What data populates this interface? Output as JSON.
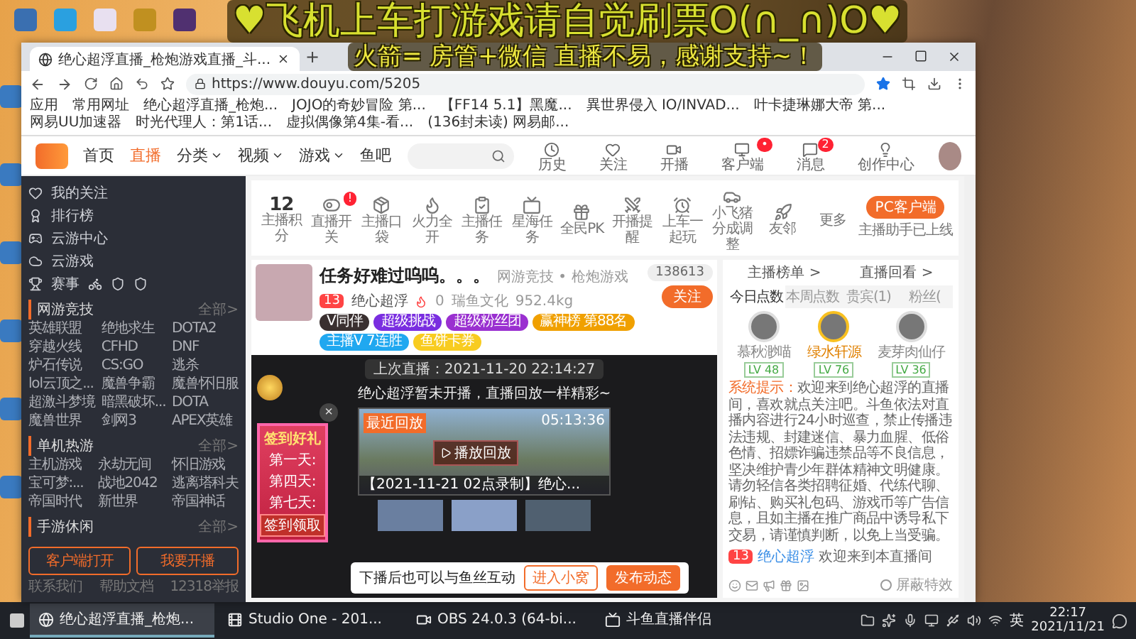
{
  "overlay": {
    "line_1": "♥飞机上车打游戏请自觉刷票O(∩_∩)O♥",
    "line_2": "火箭= 房管+微信 直播不易，感谢支持~！"
  },
  "browser": {
    "tab_title": "绝心超浮直播_枪炮游戏直播_斗...",
    "new_tab": "+",
    "url": "https://www.douyu.com/5205",
    "bookmarks": [
      "应用",
      "常用网址",
      "绝心超浮直播_枪炮...",
      "JOJO的奇妙冒险 第...",
      "【FF14 5.1】黑魔...",
      "異世界侵入 IO/INVAD...",
      "叶卡捷琳娜大帝 第...",
      "网易UU加速器",
      "时光代理人：第1话...",
      "虚拟偶像第4集-看...",
      "(136封未读) 网易邮..."
    ]
  },
  "site": {
    "nav": [
      {
        "label": "首页",
        "selected": false,
        "dropdown": false
      },
      {
        "label": "直播",
        "selected": true,
        "dropdown": false
      },
      {
        "label": "分类",
        "selected": false,
        "dropdown": true
      },
      {
        "label": "视频",
        "selected": false,
        "dropdown": true
      },
      {
        "label": "游戏",
        "selected": false,
        "dropdown": true
      },
      {
        "label": "鱼吧",
        "selected": false,
        "dropdown": false
      }
    ],
    "actions": [
      {
        "label": "历史"
      },
      {
        "label": "关注"
      },
      {
        "label": "开播"
      },
      {
        "label": "客户端",
        "badge": "•"
      },
      {
        "label": "消息",
        "badge": "2"
      },
      {
        "label": "创作中心"
      }
    ]
  },
  "sidebar": {
    "items": [
      "我的关注",
      "排行榜",
      "云游中心",
      "云游戏",
      "赛事"
    ],
    "sections": [
      {
        "title": "网游竞技",
        "more": "全部>",
        "games": [
          "英雄联盟",
          "绝地求生",
          "DOTA2",
          "穿越火线",
          "CFHD",
          "DNF",
          "炉石传说",
          "CS:GO",
          "逃杀",
          "lol云顶之...",
          "魔兽争霸",
          "魔兽怀旧服",
          "超激斗梦境",
          "暗黑破坏...",
          "DOTA",
          "魔兽世界",
          "剑网3",
          "APEX英雄"
        ]
      },
      {
        "title": "单机热游",
        "more": "全部>",
        "games": [
          "主机游戏",
          "永劫无间",
          "怀旧游戏",
          "宝可梦:...",
          "战地2042",
          "逃离塔科夫",
          "帝国时代",
          "新世界",
          "帝国神话"
        ]
      },
      {
        "title": "手游休闲",
        "more": "全部>"
      }
    ],
    "buttons": [
      "客户端打开",
      "我要开播"
    ],
    "footer": [
      "联系我们",
      "帮助文档",
      "12318举报"
    ]
  },
  "anchor_tools": {
    "score": "12",
    "score_label": "主播积分",
    "tools": [
      {
        "label": "直播开关",
        "badge": "!"
      },
      {
        "label": "主播口袋"
      },
      {
        "label": "火力全开"
      },
      {
        "label": "主播任务"
      },
      {
        "label": "星海任务"
      },
      {
        "label": "全民PK"
      },
      {
        "label": "开播提醒"
      },
      {
        "label": "上车一起玩"
      },
      {
        "label": "小飞猪分成调整"
      },
      {
        "label": "友邻"
      },
      {
        "label": "更多"
      }
    ],
    "pc_button": "PC客户端",
    "pc_note": "主播助手已上线"
  },
  "room": {
    "title": "任务好难过呜呜。。。",
    "category": "网游竞技 • 枪炮游戏",
    "level": "13",
    "anchor": "绝心超浮",
    "heat": "0",
    "guild": "瑞鱼文化",
    "weight": "952.4kg",
    "followers": "138613",
    "follow": "关注",
    "chips": [
      {
        "label": "V同伴",
        "color": "#3a3030"
      },
      {
        "label": "超级挑战",
        "color": "#7a2ee0"
      },
      {
        "label": "超级粉丝团",
        "color": "#9a30d0"
      },
      {
        "label": "赢神榜 第88名",
        "color": "#f0a000"
      },
      {
        "label": "主播V 7连胜",
        "color": "#20a8f0"
      },
      {
        "label": "鱼饼卡券",
        "color": "#f8cc20"
      }
    ],
    "last_live": "上次直播：2021-11-20 22:14:27",
    "offline_note": "绝心超浮暂未开播，直播回放一样精彩~",
    "replay_tag": "最近回放",
    "replay_time": "05:13:36",
    "replay_button": "播放回放",
    "replay_caption": "【2021-11-21 02点录制】绝心...",
    "promo": {
      "title": "签到好礼",
      "days": [
        "第一天:",
        "第四天:",
        "第七天:"
      ],
      "button": "签到领取",
      "close": "×"
    },
    "banner": {
      "text": "下播后也可以与鱼丝互动",
      "buttons": [
        "进入小窝",
        "发布动态"
      ]
    }
  },
  "rank": {
    "links": [
      "主播榜单 >",
      "直播回看 >"
    ],
    "tabs": [
      {
        "label": "今日点数",
        "selected": true
      },
      {
        "label": "本周点数",
        "selected": false
      },
      {
        "label": "贵宾(1)",
        "selected": false
      },
      {
        "label": "粉丝(",
        "selected": false
      }
    ],
    "users": [
      {
        "name": "慕秋渺喵",
        "level": "LV 48",
        "highlight": false
      },
      {
        "name": "绿水轩源",
        "level": "LV 76",
        "highlight": true
      },
      {
        "name": "麦芽肉仙仔",
        "level": "LV 36",
        "highlight": false
      }
    ],
    "notice_label": "系统提示：",
    "notice": "欢迎来到绝心超浮的直播间，喜欢就点关注吧。斗鱼依法对直播内容进行24小时巡查，禁止传播违法违规、封建迷信、暴力血腥、低俗色情、招嫖诈骗违禁品等不良信息，坚决维护青少年群体精神文明健康。请勿轻信各类招聘征婚、代练代聊、刷钻、购买礼包码、游戏币等广告信息，且如主播在推广商品中诱导私下交易，请谨慎判断，以免上当受骗。",
    "welcome_level": "13",
    "welcome_user": "绝心超浮",
    "welcome_text": "欢迎来到本直播间",
    "block_effects": {
      "label": "屏蔽特效",
      "checked": false
    }
  },
  "taskbar": {
    "items": [
      {
        "label": "绝心超浮直播_枪炮...",
        "selected": true
      },
      {
        "label": "Studio One - 201...",
        "selected": false
      },
      {
        "label": "OBS 24.0.3 (64-bi...",
        "selected": false
      },
      {
        "label": "斗鱼直播伴侣",
        "selected": false
      }
    ],
    "ime": "英",
    "time": "22:17",
    "date": "2021/11/21"
  }
}
